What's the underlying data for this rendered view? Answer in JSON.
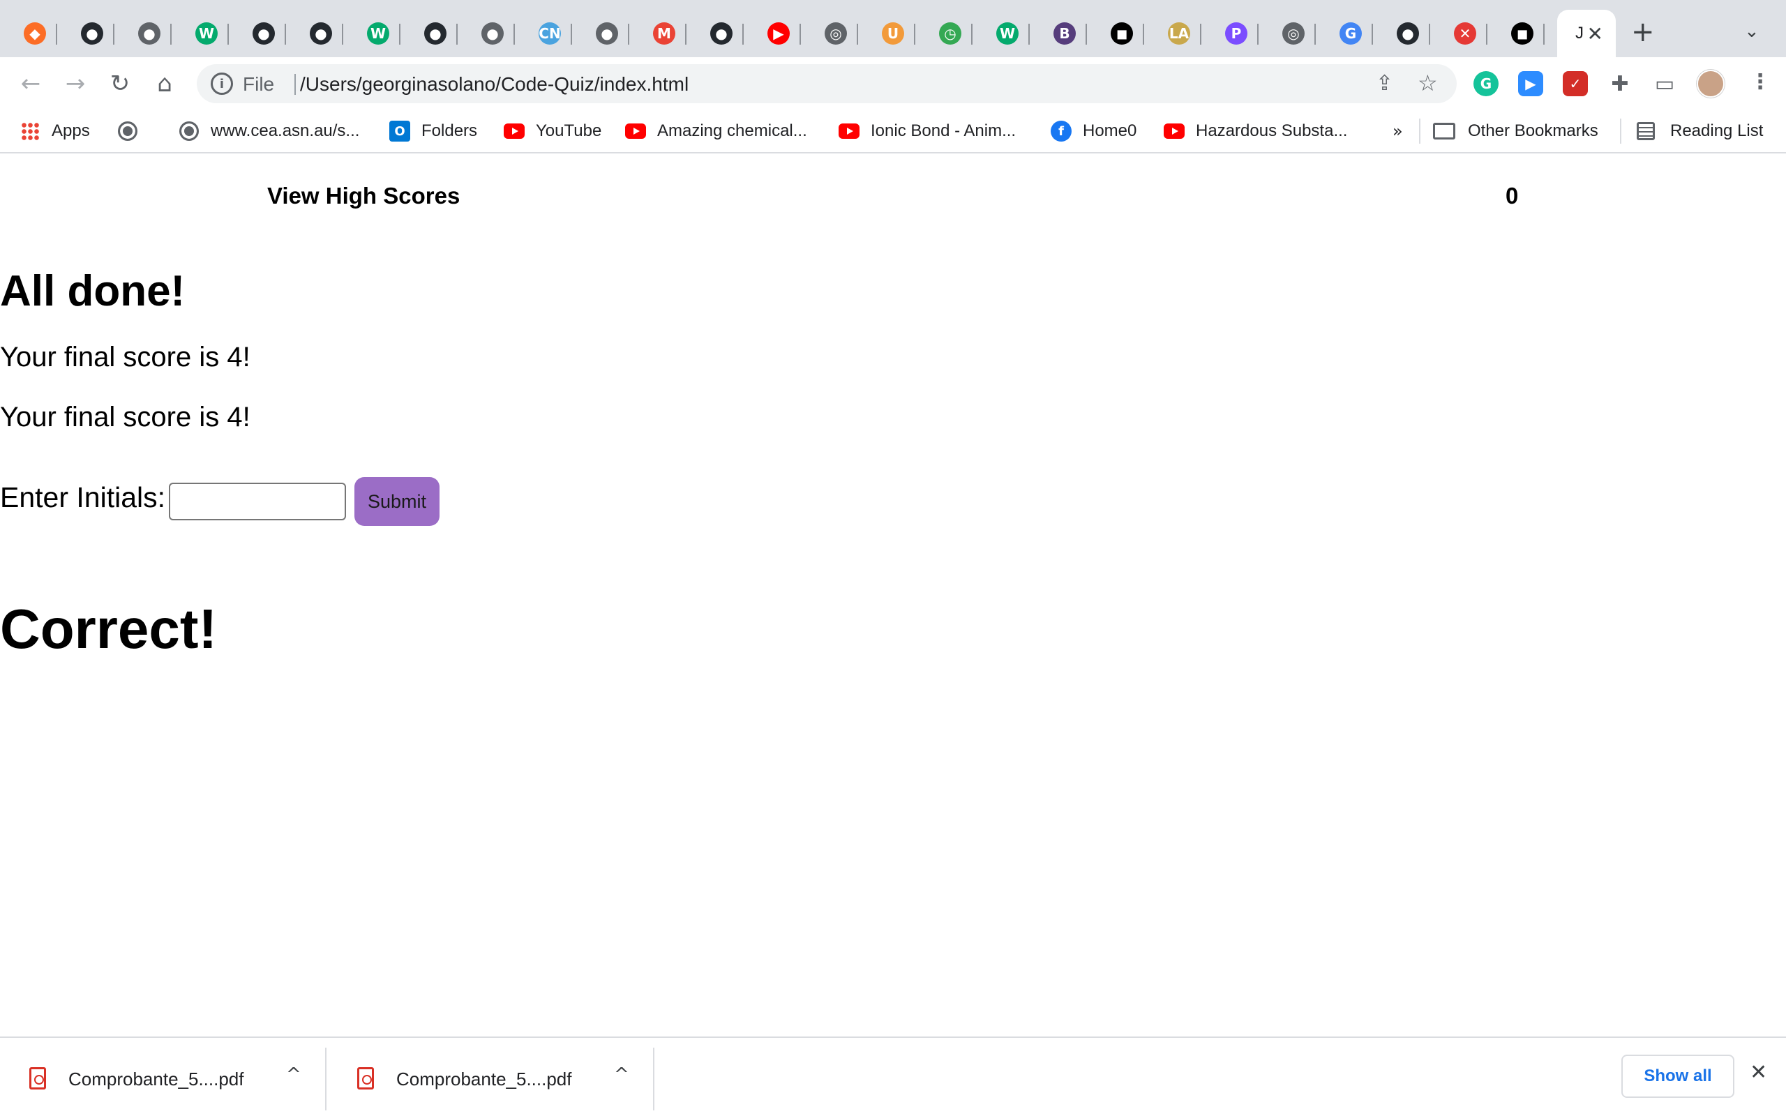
{
  "browser": {
    "tabs": [
      {
        "icon": "gitlab-icon",
        "glyph": "◆",
        "color": "#fc6d26"
      },
      {
        "icon": "github-icon",
        "glyph": "●",
        "color": "#24292f"
      },
      {
        "icon": "globe-icon",
        "glyph": "●",
        "color": "#5f6368"
      },
      {
        "icon": "w3schools-icon",
        "glyph": "W",
        "color": "#04aa6d"
      },
      {
        "icon": "github-icon",
        "glyph": "●",
        "color": "#24292f"
      },
      {
        "icon": "github-icon",
        "glyph": "●",
        "color": "#24292f"
      },
      {
        "icon": "w3schools-icon",
        "glyph": "W",
        "color": "#04aa6d"
      },
      {
        "icon": "github-icon",
        "glyph": "●",
        "color": "#24292f"
      },
      {
        "icon": "globe-icon",
        "glyph": "●",
        "color": "#5f6368"
      },
      {
        "icon": "cn-icon",
        "glyph": "CN",
        "color": "#4aa3df"
      },
      {
        "icon": "globe-icon",
        "glyph": "●",
        "color": "#5f6368"
      },
      {
        "icon": "gmail-icon",
        "glyph": "M",
        "color": "#ea4335"
      },
      {
        "icon": "github-icon",
        "glyph": "●",
        "color": "#24292f"
      },
      {
        "icon": "youtube-icon",
        "glyph": "▶",
        "color": "#ff0000"
      },
      {
        "icon": "chrome-icon",
        "glyph": "◎",
        "color": "#5f6368"
      },
      {
        "icon": "shield-icon",
        "glyph": "U",
        "color": "#f29a3a"
      },
      {
        "icon": "clock-icon",
        "glyph": "◷",
        "color": "#34a853"
      },
      {
        "icon": "w3schools-icon",
        "glyph": "W",
        "color": "#04aa6d"
      },
      {
        "icon": "bootstrap-icon",
        "glyph": "B",
        "color": "#563d7c"
      },
      {
        "icon": "notion-icon",
        "glyph": "◼",
        "color": "#000000"
      },
      {
        "icon": "lavt-icon",
        "glyph": "LA",
        "color": "#c9a84c"
      },
      {
        "icon": "picsart-icon",
        "glyph": "P",
        "color": "#7b4dff"
      },
      {
        "icon": "chrome-icon",
        "glyph": "◎",
        "color": "#5f6368"
      },
      {
        "icon": "google-icon",
        "glyph": "G",
        "color": "#4285f4"
      },
      {
        "icon": "github-icon",
        "glyph": "●",
        "color": "#24292f"
      },
      {
        "icon": "x-tools-icon",
        "glyph": "✕",
        "color": "#e53935"
      },
      {
        "icon": "notion-icon",
        "glyph": "◼",
        "color": "#000000"
      }
    ],
    "active_tab": {
      "title": "J",
      "close": "✕"
    },
    "new_tab": "+",
    "tab_search": "⌄"
  },
  "toolbar": {
    "back": "←",
    "forward": "→",
    "reload": "↻",
    "home": "⌂",
    "scheme": "File",
    "url": "/Users/georginasolano/Code-Quiz/index.html",
    "share": "⇪",
    "star": "☆",
    "extensions": [
      {
        "icon": "grammarly-icon",
        "glyph": "G",
        "color": "#15c39a"
      },
      {
        "icon": "zoom-icon",
        "glyph": "▶",
        "color": "#2d8cff"
      },
      {
        "icon": "lastpass-icon",
        "glyph": "✓",
        "color": "#d32d27"
      },
      {
        "icon": "puzzle-icon",
        "glyph": "✚",
        "color": "#5f6368"
      },
      {
        "icon": "cast-icon",
        "glyph": "▭",
        "color": "#5f6368"
      }
    ],
    "menu": "⋮"
  },
  "bookmarks": {
    "apps": "Apps",
    "items": [
      {
        "label": "",
        "icon": "globe-icon"
      },
      {
        "label": "www.cea.asn.au/s...",
        "icon": "globe-icon"
      },
      {
        "label": "Folders",
        "icon": "outlook-icon"
      },
      {
        "label": "YouTube",
        "icon": "youtube-icon"
      },
      {
        "label": "Amazing chemical...",
        "icon": "youtube-icon"
      },
      {
        "label": "Ionic Bond - Anim...",
        "icon": "youtube-icon"
      },
      {
        "label": "Home0",
        "icon": "facebook-icon"
      },
      {
        "label": "Hazardous Substa...",
        "icon": "youtube-icon"
      }
    ],
    "overflow": "»",
    "other": "Other Bookmarks",
    "reading_list": "Reading List"
  },
  "quiz": {
    "high_scores_link": "View High Scores",
    "timer": "0",
    "heading": "All done!",
    "score_lines": [
      "Your final score is 4!",
      "Your final score is 4!"
    ],
    "initials_label": "Enter Initials:",
    "initials_value": "",
    "submit_label": "Submit",
    "feedback": "Correct!",
    "submit_color": "#9b6dc6"
  },
  "downloads": {
    "items": [
      {
        "name": "Comprobante_5....pdf",
        "caret": "^"
      },
      {
        "name": "Comprobante_5....pdf",
        "caret": "^"
      }
    ],
    "show_all": "Show all",
    "close": "✕"
  }
}
